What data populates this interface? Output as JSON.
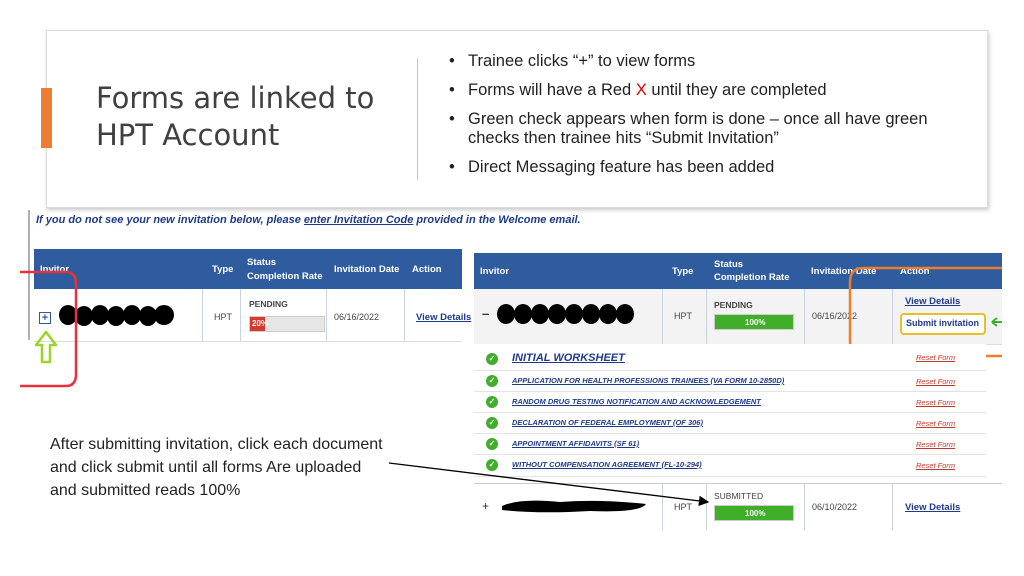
{
  "slide": {
    "title_line1": "Forms are linked to",
    "title_line2": "HPT Account",
    "bullets": {
      "b1": "Trainee clicks “+” to view forms",
      "b2_pre": "Forms will have a Red ",
      "b2_x": "X",
      "b2_post": " until they are completed",
      "b3": "Green check appears when form is done – once all have green checks then trainee hits “Submit Invitation”",
      "b4": "Direct Messaging feature has been added"
    },
    "caption": "After submitting invitation, click each document and click submit until all forms Are uploaded and submitted reads 100%",
    "colors": {
      "accent": "#ed7d31",
      "red_x": "#e00000",
      "header_blue": "#2e5c9e",
      "progress_green": "#3fae28",
      "annotation_red": "#e8313b",
      "annotation_orange": "#f07d29",
      "arrow_lime": "#9bd429"
    }
  },
  "shot1": {
    "note_pre": "If you do not see your new invitation below, please ",
    "note_link": "enter Invitation Code",
    "note_post": " provided in the Welcome email.",
    "headers": {
      "invitor": "Invitor",
      "type": "Type",
      "status1": "Status",
      "status2": "Completion Rate",
      "date": "Invitation Date",
      "action": "Action"
    },
    "row": {
      "expand": "+",
      "type": "HPT",
      "status": "PENDING",
      "progress_label": "20%",
      "progress": 0.2,
      "date": "06/16/2022",
      "action": "View Details"
    }
  },
  "shot2": {
    "headers": {
      "invitor": "Invitor",
      "type": "Type",
      "status1": "Status",
      "status2": "Completion Rate",
      "date": "Invitation Date",
      "action": "Action"
    },
    "row1": {
      "collapse": "–",
      "type": "HPT",
      "status": "PENDING",
      "progress_label": "100%",
      "progress": 1.0,
      "date": "06/16/2022",
      "view": "View Details",
      "submit": "Submit invitation"
    },
    "forms": [
      {
        "label": "INITIAL WORKSHEET",
        "reset": "Reset Form"
      },
      {
        "label": "APPLICATION FOR HEALTH PROFESSIONS TRAINEES (VA FORM 10-2850D)",
        "reset": "Reset Form"
      },
      {
        "label": "RANDOM DRUG TESTING NOTIFICATION AND ACKNOWLEDGEMENT",
        "reset": "Reset Form"
      },
      {
        "label": "DECLARATION OF FEDERAL EMPLOYMENT (OF 306)",
        "reset": "Reset Form"
      },
      {
        "label": "APPOINTMENT AFFIDAVITS (SF 61)",
        "reset": "Reset Form"
      },
      {
        "label": "WITHOUT COMPENSATION AGREEMENT (FL-10-294)",
        "reset": "Reset Form"
      }
    ],
    "row2": {
      "expand": "+",
      "type": "HPT",
      "status": "SUBMITTED",
      "progress_label": "100%",
      "progress": 1.0,
      "date": "06/10/2022",
      "view": "View Details"
    }
  }
}
